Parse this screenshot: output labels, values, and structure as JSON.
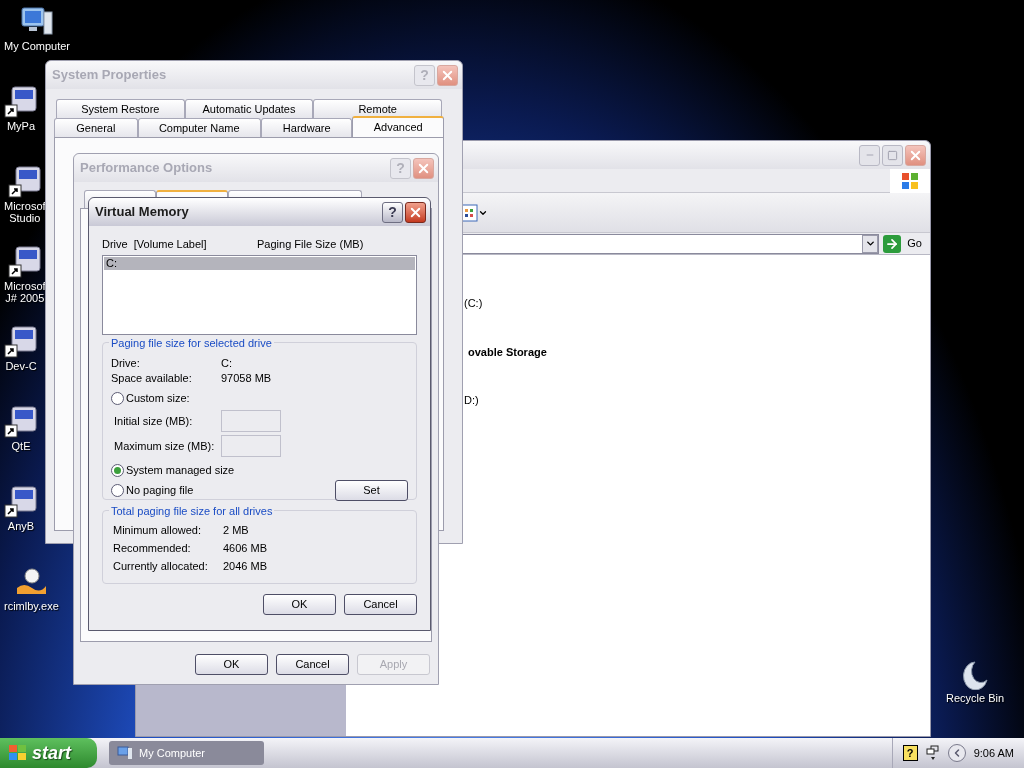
{
  "desktop_icons": [
    {
      "kind": "computer",
      "lines": [
        "My Computer"
      ]
    },
    {
      "kind": "shortcut",
      "lines": [
        "MyPa"
      ]
    },
    {
      "kind": "shortcut",
      "lines": [
        "Microsof",
        "Studio"
      ]
    },
    {
      "kind": "shortcut",
      "lines": [
        "Microsof",
        "J# 2005"
      ]
    },
    {
      "kind": "shortcut",
      "lines": [
        "Dev-C"
      ]
    },
    {
      "kind": "shortcut",
      "lines": [
        "QtE"
      ]
    },
    {
      "kind": "shortcut",
      "lines": [
        "AnyB"
      ]
    },
    {
      "kind": "program",
      "lines": [
        "rcimlby.exe"
      ]
    }
  ],
  "recycle_bin": {
    "label": "Recycle Bin"
  },
  "explorer": {
    "active": false,
    "go_button": "Go",
    "items": [
      {
        "kind": "drive",
        "label": "(C:)"
      },
      {
        "kind": "heading",
        "label": "ovable Storage"
      },
      {
        "kind": "drive",
        "label": "D:)"
      }
    ]
  },
  "system_properties": {
    "title": "System Properties",
    "active": false,
    "help": "?",
    "tabs_back": [
      {
        "label": "System Restore",
        "selected": false
      },
      {
        "label": "Automatic Updates",
        "selected": false
      },
      {
        "label": "Remote",
        "selected": false
      }
    ],
    "tabs_front": [
      {
        "label": "General",
        "selected": false
      },
      {
        "label": "Computer Name",
        "selected": false
      },
      {
        "label": "Hardware",
        "selected": false
      },
      {
        "label": "Advanced",
        "selected": true
      }
    ]
  },
  "performance_options": {
    "title": "Performance Options",
    "active": false,
    "help": "?",
    "tabs": [
      {
        "selected": false
      },
      {
        "selected": true
      },
      {
        "selected": false
      }
    ],
    "buttons": [
      {
        "label": "OK",
        "disabled": false
      },
      {
        "label": "Cancel",
        "disabled": false
      },
      {
        "label": "Apply",
        "disabled": true
      }
    ]
  },
  "virtual_memory": {
    "title": "Virtual Memory",
    "active": true,
    "help": "?",
    "list_columns": [
      "Drive  [Volume Label]",
      "Paging File Size (MB)"
    ],
    "drives": [
      {
        "drive": "C:",
        "selected": true
      }
    ],
    "selected_drive_group": {
      "title": "Paging file size for selected drive",
      "info": [
        {
          "label": "Drive:",
          "value": "C:"
        },
        {
          "label": "Space available:",
          "value": "97058 MB"
        }
      ],
      "options": [
        {
          "kind": "radio",
          "label": "Custom size:",
          "selected": false
        },
        {
          "kind": "field",
          "label": "Initial size (MB):",
          "disabled": true
        },
        {
          "kind": "field",
          "label": "Maximum size (MB):",
          "disabled": true
        },
        {
          "kind": "radio",
          "label": "System managed size",
          "selected": true
        },
        {
          "kind": "radio",
          "label": "No paging file",
          "selected": false
        }
      ],
      "set_button": "Set"
    },
    "totals_group": {
      "title": "Total paging file size for all drives",
      "rows": [
        {
          "label": "Minimum allowed:",
          "value": "2 MB"
        },
        {
          "label": "Recommended:",
          "value": "4606 MB"
        },
        {
          "label": "Currently allocated:",
          "value": "2046 MB"
        }
      ]
    },
    "buttons": [
      "OK",
      "Cancel"
    ]
  },
  "taskbar": {
    "start": "start",
    "tasks": [
      {
        "label": "My Computer",
        "selected": true
      }
    ],
    "help": "?",
    "clock": "9:06 AM"
  }
}
